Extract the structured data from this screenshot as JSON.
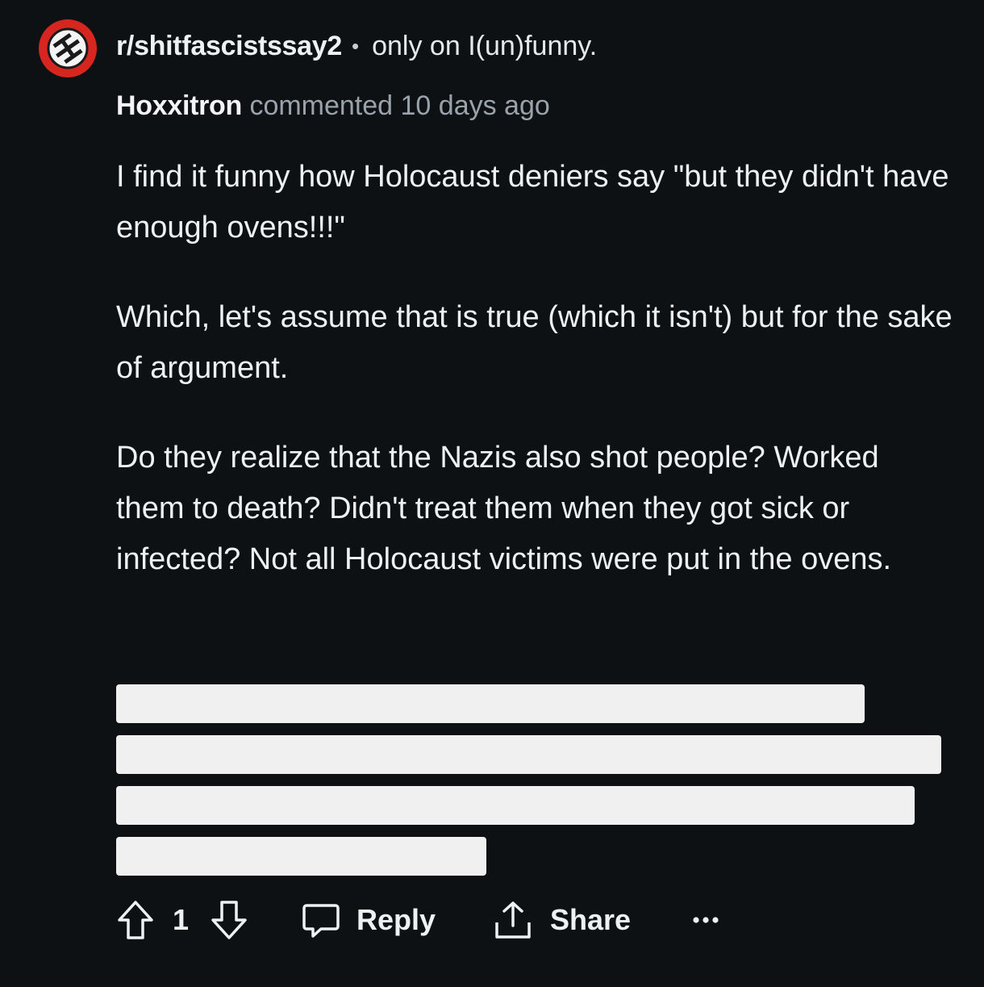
{
  "header": {
    "subreddit": "r/shitfascistssay2",
    "separator": "•",
    "promo": "only on I(un)funny."
  },
  "comment": {
    "author": "Hoxxitron",
    "meta": "commented 10 days ago",
    "paragraphs": [
      "I find it funny how Holocaust deniers say \"but they didn't have enough ovens!!!\"",
      "Which, let's assume that is true (which it isn't) but for the sake of argument.",
      "Do they realize that the Nazis also shot people? Worked them to death? Didn't treat them when they got sick or infected? Not all Holocaust victims were put in the ovens."
    ]
  },
  "actions": {
    "vote_count": "1",
    "reply_label": "Reply",
    "share_label": "Share"
  },
  "icons": {
    "avatar": "subreddit-avatar-icon",
    "upvote": "upvote-arrow-icon",
    "downvote": "downvote-arrow-icon",
    "reply": "speech-bubble-icon",
    "share": "share-upload-icon",
    "more": "more-dots-icon"
  },
  "colors": {
    "background": "#0e1114",
    "avatar": "#d7251f",
    "meta_text": "#9aa3ab",
    "redaction": "#f0f0f0"
  }
}
